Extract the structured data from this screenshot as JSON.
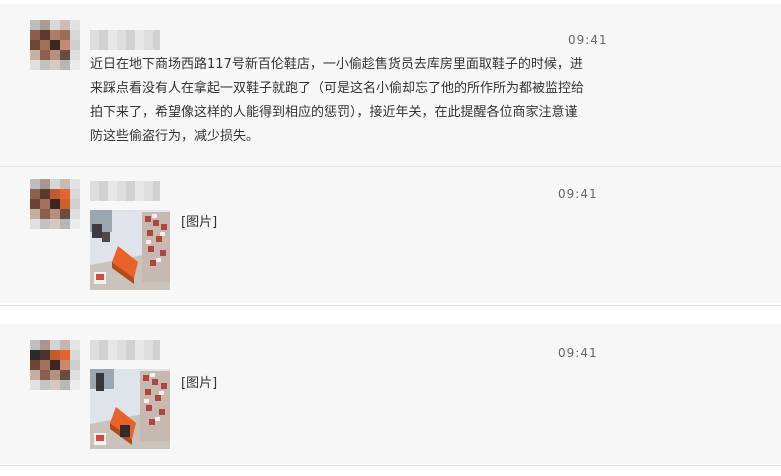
{
  "messages": [
    {
      "time": "09:41",
      "text": "近日在地下商场西路117号新百伦鞋店，一小偷趁售货员去库房里面取鞋子的时候，进来踩点看没有人在拿起一双鞋子就跑了（可是这名小偷却忘了他的所作所为都被监控给拍下来了，希望像这样的人能得到相应的惩罚），接近年关，在此提醒各位商家注意谨防这些偷盗行为，减少损失。"
    },
    {
      "time": "09:41",
      "image_label": "[图片]"
    },
    {
      "time": "09:41",
      "image_label": "[图片]"
    }
  ],
  "colors": {
    "row_background": "#f7f7f7",
    "separator": "#e3e3e3",
    "sofa_orange": "#e8622a"
  }
}
